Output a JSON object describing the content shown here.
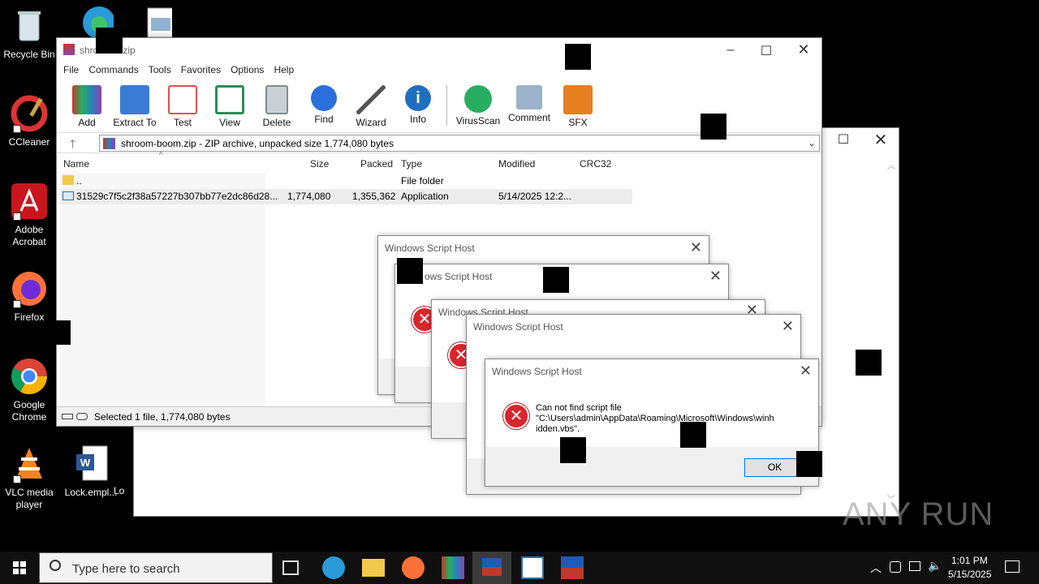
{
  "desktop": {
    "icons": [
      {
        "label": "Recycle Bin"
      },
      {
        "label": "CCleaner"
      },
      {
        "label": "Adobe Acrobat"
      },
      {
        "label": "Firefox"
      },
      {
        "label": "Google Chrome"
      },
      {
        "label": "VLC media player"
      },
      {
        "label": "Lock.empl..."
      },
      {
        "label": "Lo"
      }
    ]
  },
  "winrar": {
    "title": "shro    oom.zip",
    "menu": [
      "File",
      "Commands",
      "Tools",
      "Favorites",
      "Options",
      "Help"
    ],
    "toolbar": [
      {
        "label": "Add",
        "icon": "add-icon",
        "color": "#c0392b"
      },
      {
        "label": "Extract To",
        "icon": "extract-icon",
        "color": "#3a7bd5"
      },
      {
        "label": "Test",
        "icon": "test-icon",
        "color": "#d9534f"
      },
      {
        "label": "View",
        "icon": "view-icon",
        "color": "#2e8b57"
      },
      {
        "label": "Delete",
        "icon": "delete-icon",
        "color": "#7f8c8d"
      },
      {
        "label": "Find",
        "icon": "find-icon",
        "color": "#2a6fdb"
      },
      {
        "label": "Wizard",
        "icon": "wizard-icon",
        "color": "#8e44ad"
      },
      {
        "label": "Info",
        "icon": "info-icon",
        "color": "#1f6fbf"
      },
      {
        "label": "VirusScan",
        "icon": "virusscan-icon",
        "color": "#27ae60"
      },
      {
        "label": "Comment",
        "icon": "comment-icon",
        "color": "#5d7fa3"
      },
      {
        "label": "SFX",
        "icon": "sfx-icon",
        "color": "#e67e22"
      }
    ],
    "path": "shroom-boom.zip - ZIP archive, unpacked size 1,774,080 bytes",
    "columns": [
      "Name",
      "Size",
      "Packed",
      "Type",
      "Modified",
      "CRC32"
    ],
    "rows": [
      {
        "name": "..",
        "size": "",
        "packed": "",
        "type": "File folder",
        "modified": ""
      },
      {
        "name": "31529c7f5c2f38a57227b307bb77e2dc86d28...",
        "size": "1,774,080",
        "packed": "1,355,362",
        "type": "Application",
        "modified": "5/14/2025 12:2..."
      }
    ],
    "status": "Selected 1 file, 1,774,080 bytes"
  },
  "dialogs": {
    "title": "Windows Script Host",
    "title_partial_1": "ows Script Host",
    "message_line1": "Can not find script file",
    "message_line2": "\"C:\\Users\\admin\\AppData\\Roaming\\Microsoft\\Windows\\winh",
    "message_line3": "idden.vbs\".",
    "ok": "OK"
  },
  "taskbar": {
    "search_placeholder": "Type here to search",
    "time": "1:01 PM",
    "date": "5/15/2025"
  },
  "watermark": "ANY RUN"
}
